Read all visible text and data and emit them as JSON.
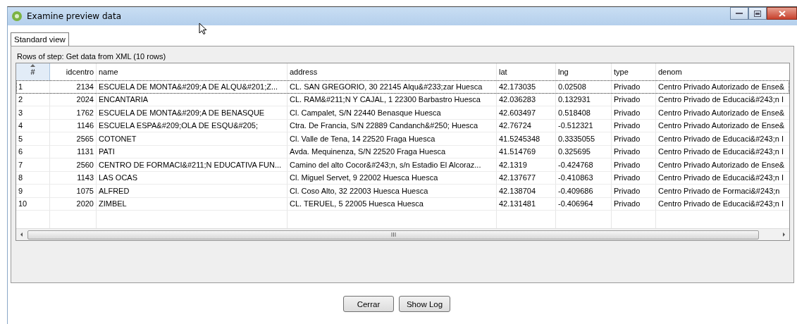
{
  "window": {
    "title": "Examine preview data"
  },
  "tabs": [
    {
      "label": "Standard view",
      "selected": true
    }
  ],
  "caption": "Rows of step: Get data from XML (10 rows)",
  "table": {
    "columns": [
      "#",
      "idcentro",
      "name",
      "address",
      "lat",
      "lng",
      "type",
      "denom"
    ],
    "rows": [
      {
        "selected": true,
        "cells": [
          "1",
          "2134",
          "ESCUELA DE MONTA&#209;A DE ALQU&#201;Z...",
          "CL. SAN GREGORIO, 30 22145 Alqu&#233;zar Huesca",
          "42.173035",
          "0.02508",
          "Privado",
          "Centro Privado Autorizado de Ense&"
        ]
      },
      {
        "selected": false,
        "cells": [
          "2",
          "2024",
          "ENCANTARIA",
          "CL. RAM&#211;N Y CAJAL, 1 22300 Barbastro Huesca",
          "42.036283",
          "0.132931",
          "Privado",
          "Centro Privado de Educaci&#243;n I"
        ]
      },
      {
        "selected": false,
        "cells": [
          "3",
          "1762",
          "ESCUELA DE MONTA&#209;A DE BENASQUE",
          "Cl. Campalet, S/N 22440 Benasque Huesca",
          "42.603497",
          "0.518408",
          "Privado",
          "Centro Privado Autorizado de Ense&"
        ]
      },
      {
        "selected": false,
        "cells": [
          "4",
          "1146",
          "ESCUELA ESPA&#209;OLA DE ESQU&#205;",
          "Ctra. De Francia, S/N 22889 Candanch&#250; Huesca",
          "42.76724",
          "-0.512321",
          "Privado",
          "Centro Privado Autorizado de Ense&"
        ]
      },
      {
        "selected": false,
        "cells": [
          "5",
          "2565",
          "COTONET",
          "Cl. Valle de Tena, 14 22520 Fraga Huesca",
          "41.5245348",
          "0.3335055",
          "Privado",
          "Centro Privado de Educaci&#243;n I"
        ]
      },
      {
        "selected": false,
        "cells": [
          "6",
          "1131",
          "PATI",
          "Avda. Mequinenza, S/N 22520 Fraga Huesca",
          "41.514769",
          "0.325695",
          "Privado",
          "Centro Privado de Educaci&#243;n I"
        ]
      },
      {
        "selected": false,
        "cells": [
          "7",
          "2560",
          "CENTRO DE FORMACI&#211;N EDUCATIVA FUN...",
          "Camino del alto Cocor&#243;n, s/n Estadio El Alcoraz...",
          "42.1319",
          "-0.424768",
          "Privado",
          "Centro Privado Autorizado de Ense&"
        ]
      },
      {
        "selected": false,
        "cells": [
          "8",
          "1143",
          "LAS OCAS",
          "Cl.  Miguel Servet, 9 22002 Huesca Huesca",
          "42.137677",
          "-0.410863",
          "Privado",
          "Centro Privado de Educaci&#243;n I"
        ]
      },
      {
        "selected": false,
        "cells": [
          "9",
          "1075",
          "ALFRED",
          "Cl. Coso Alto, 32 22003 Huesca Huesca",
          "42.138704",
          "-0.409686",
          "Privado",
          "Centro Privado de Formaci&#243;n"
        ]
      },
      {
        "selected": false,
        "cells": [
          "10",
          "2020",
          "ZIMBEL",
          "CL. TERUEL, 5 22005 Huesca Huesca",
          "42.131481",
          "-0.406964",
          "Privado",
          "Centro Privado de Educaci&#243;n I"
        ]
      }
    ]
  },
  "buttons": [
    {
      "label": "Cerrar"
    },
    {
      "label": "Show Log"
    }
  ]
}
